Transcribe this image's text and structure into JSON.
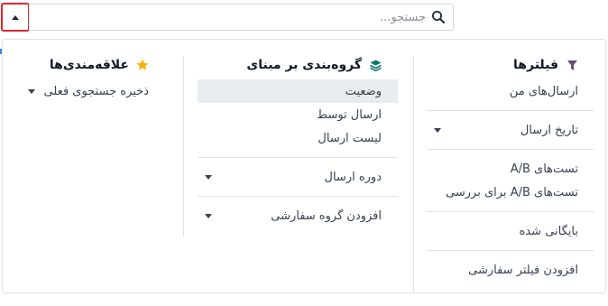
{
  "search": {
    "placeholder": "جستجو..."
  },
  "colors": {
    "annotation": "#e0262c",
    "filter_icon": "#6b4f7a",
    "group_icon": "#0f766e",
    "favorite_icon": "#f5b301"
  },
  "filters": {
    "title": "فیلترها",
    "icon": "filter-icon",
    "items": [
      {
        "label": "ارسال‌های من"
      },
      {
        "label": "تاریخ ارسال",
        "has_submenu": true
      },
      {
        "label": "تست‌های A/B"
      },
      {
        "label": "تست‌های A/B برای بررسی"
      },
      {
        "label": "بایگانی شده"
      },
      {
        "label": "افزودن فیلتر سفارشی"
      }
    ]
  },
  "group_by": {
    "title": "گروه‌بندی بر مبنای",
    "icon": "layers-icon",
    "items": [
      {
        "label": "وضعیت",
        "active": true
      },
      {
        "label": "ارسال توسط"
      },
      {
        "label": "لیست ارسال"
      },
      {
        "label": "دوره ارسال",
        "has_submenu": true
      },
      {
        "label": "افزودن گروه سفارشی",
        "has_submenu": true
      }
    ]
  },
  "favorites": {
    "title": "علاقه‌مندی‌ها",
    "icon": "star-icon",
    "items": [
      {
        "label": "ذخیره جستجوی فعلی",
        "has_submenu": true
      }
    ]
  }
}
